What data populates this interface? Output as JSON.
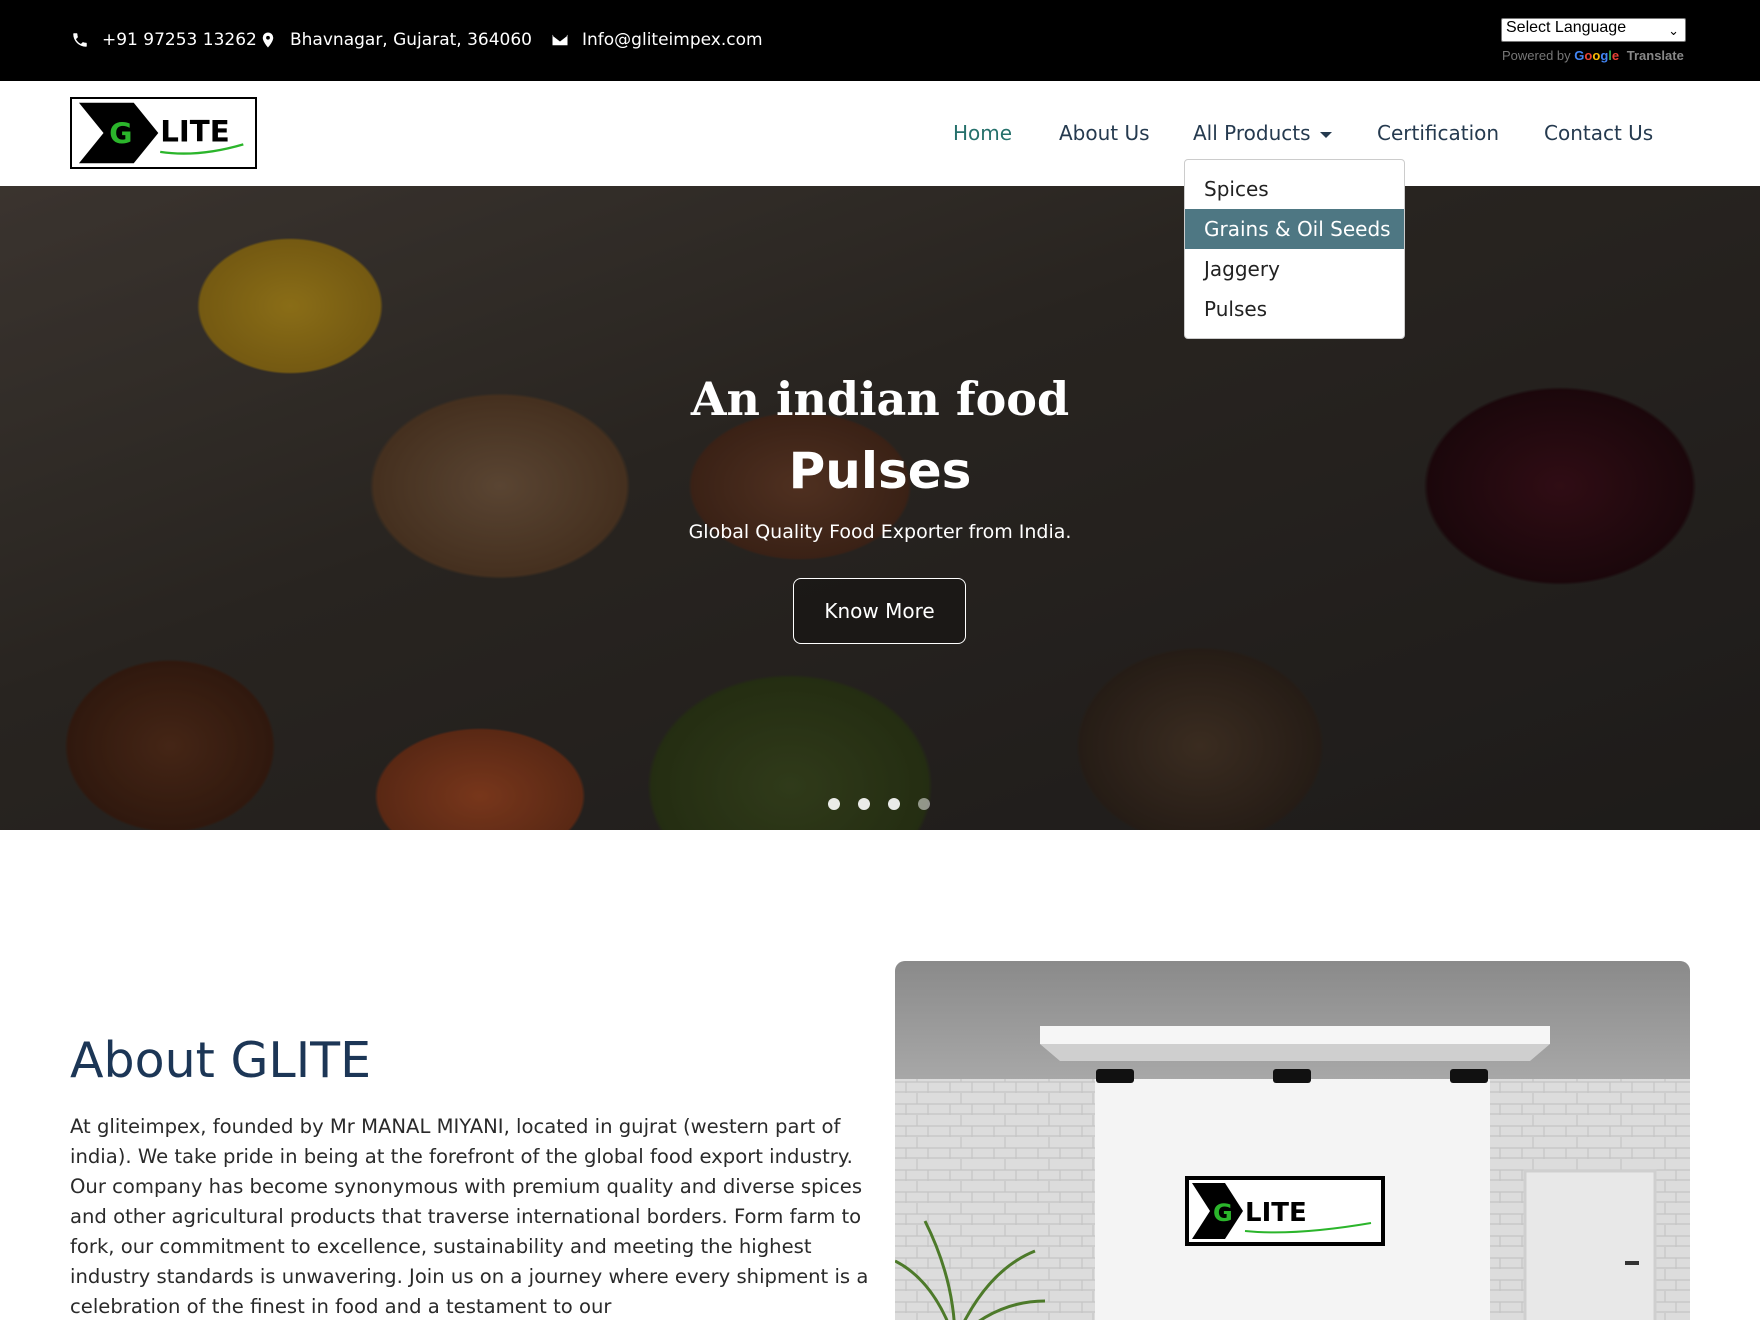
{
  "topbar": {
    "phone": "+91 97253 13262",
    "address": "Bhavnagar, Gujarat, 364060",
    "email": "Info@gliteimpex.com",
    "language_select": "Select Language",
    "powered_by": "Powered by",
    "google": "Google",
    "translate": "Translate",
    "icons": [
      "phone-icon",
      "location-pin-icon",
      "envelope-icon"
    ]
  },
  "brand": {
    "logo_text": "LITE",
    "logo_letter": "G",
    "colors": {
      "green": "#2bb52b",
      "dark": "#000000"
    }
  },
  "nav": {
    "items": [
      {
        "label": "Home",
        "active": true
      },
      {
        "label": "About Us",
        "active": false
      },
      {
        "label": "All Products",
        "active": false,
        "has_dropdown": true
      },
      {
        "label": "Certification",
        "active": false
      },
      {
        "label": "Contact Us",
        "active": false
      }
    ],
    "dropdown": [
      {
        "label": "Spices"
      },
      {
        "label": "Grains & Oil Seeds",
        "highlighted": true
      },
      {
        "label": "Jaggery"
      },
      {
        "label": "Pulses"
      }
    ],
    "colors": {
      "link": "#253a4f",
      "active": "#25706b",
      "highlight_bg": "#4e7783"
    }
  },
  "hero": {
    "kicker": "An indian food",
    "title": "Pulses",
    "subtitle": "Global Quality Food Exporter from India.",
    "button": "Know More",
    "slides": 4,
    "active_slide": 4
  },
  "about": {
    "title": "About GLITE",
    "text": "At gliteimpex, founded by Mr MANAL MIYANI, located in gujrat (western part of india). We take pride in being at the forefront of the global food export industry. Our company has become synonymous with premium quality and diverse spices and other agricultural products that traverse international borders. Form farm to fork, our commitment to excellence, sustainability and meeting the highest industry standards is unwavering. Join us on a journey where every shipment is a celebration of the finest in food and a testament to our",
    "title_color": "#1c3656"
  }
}
